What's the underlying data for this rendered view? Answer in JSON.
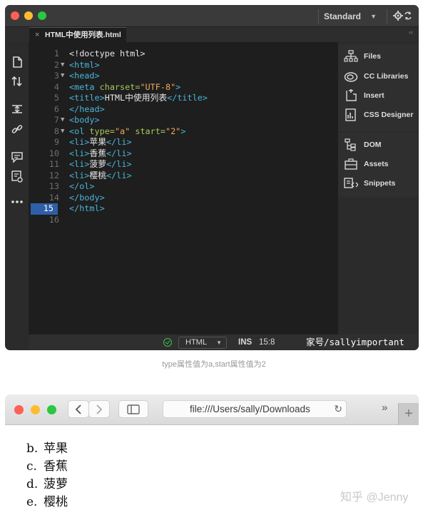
{
  "editor": {
    "workspace": "Standard",
    "tab": {
      "filename": "HTML中使用列表.html",
      "close": "×"
    },
    "collapse": "‹‹",
    "lines": [
      {
        "n": "1",
        "fold": "",
        "tokens": [
          {
            "c": "t-text",
            "t": "<!doctype html>"
          }
        ]
      },
      {
        "n": "2",
        "fold": "▼",
        "tokens": [
          {
            "c": "t-tag",
            "t": "<html>"
          }
        ]
      },
      {
        "n": "3",
        "fold": "▼",
        "tokens": [
          {
            "c": "t-tag",
            "t": "<head>"
          }
        ]
      },
      {
        "n": "4",
        "fold": "",
        "tokens": [
          {
            "c": "t-tag",
            "t": "<meta "
          },
          {
            "c": "t-attr",
            "t": "charset="
          },
          {
            "c": "t-str",
            "t": "\"UTF-8\""
          },
          {
            "c": "t-tag",
            "t": ">"
          }
        ]
      },
      {
        "n": "5",
        "fold": "",
        "tokens": [
          {
            "c": "t-tag",
            "t": "<title>"
          },
          {
            "c": "t-text",
            "t": "HTML中使用列表"
          },
          {
            "c": "t-tag",
            "t": "</title>"
          }
        ]
      },
      {
        "n": "6",
        "fold": "",
        "tokens": [
          {
            "c": "t-tag",
            "t": "</head>"
          }
        ]
      },
      {
        "n": "7",
        "fold": "▼",
        "tokens": [
          {
            "c": "t-tag",
            "t": "<body>"
          }
        ]
      },
      {
        "n": "8",
        "fold": "▼",
        "tokens": [
          {
            "c": "t-tag",
            "t": "<ol "
          },
          {
            "c": "t-attr",
            "t": "type="
          },
          {
            "c": "t-str",
            "t": "\"a\""
          },
          {
            "c": "t-attr",
            "t": " start="
          },
          {
            "c": "t-str",
            "t": "\"2\""
          },
          {
            "c": "t-tag",
            "t": ">"
          }
        ]
      },
      {
        "n": "9",
        "fold": "",
        "tokens": [
          {
            "c": "t-tag",
            "t": "<li>"
          },
          {
            "c": "t-text",
            "t": "苹果"
          },
          {
            "c": "t-tag",
            "t": "</li>"
          }
        ]
      },
      {
        "n": "10",
        "fold": "",
        "tokens": [
          {
            "c": "t-tag",
            "t": "<li>"
          },
          {
            "c": "t-text",
            "t": "香蕉"
          },
          {
            "c": "t-tag",
            "t": "</li>"
          }
        ]
      },
      {
        "n": "11",
        "fold": "",
        "tokens": [
          {
            "c": "t-tag",
            "t": "<li>"
          },
          {
            "c": "t-text",
            "t": "菠萝"
          },
          {
            "c": "t-tag",
            "t": "</li>"
          }
        ]
      },
      {
        "n": "12",
        "fold": "",
        "tokens": [
          {
            "c": "t-tag",
            "t": "<li>"
          },
          {
            "c": "t-text",
            "t": "樱桃"
          },
          {
            "c": "t-tag",
            "t": "</li>"
          }
        ]
      },
      {
        "n": "13",
        "fold": "",
        "tokens": [
          {
            "c": "t-tag",
            "t": "</ol>"
          }
        ]
      },
      {
        "n": "14",
        "fold": "",
        "tokens": [
          {
            "c": "t-tag",
            "t": "</body>"
          }
        ]
      },
      {
        "n": "15",
        "fold": "",
        "tokens": [
          {
            "c": "t-tag",
            "t": "</html>"
          }
        ]
      },
      {
        "n": "16",
        "fold": "",
        "tokens": []
      }
    ],
    "active_line": "15",
    "status": {
      "language": "HTML",
      "mode": "INS",
      "position": "15:8",
      "watermark": "家号/sallyimportant"
    }
  },
  "toolbar_icons": [
    "file-icon",
    "sort-icon",
    "expand-icon",
    "link-icon",
    "comment-icon",
    "format-icon",
    "more-icon"
  ],
  "panels": {
    "group1": [
      "Files",
      "CC Libraries",
      "Insert",
      "CSS Designer"
    ],
    "group2": [
      "DOM",
      "Assets",
      "Snippets"
    ]
  },
  "caption": "type属性值为a,start属性值为2",
  "browser": {
    "address": "file:///Users/sally/Downloads",
    "more": "»",
    "newtab": "+",
    "list": [
      {
        "marker": "b.",
        "text": "苹果"
      },
      {
        "marker": "c.",
        "text": "香蕉"
      },
      {
        "marker": "d.",
        "text": "菠萝"
      },
      {
        "marker": "e.",
        "text": "樱桃"
      }
    ],
    "watermark": "知乎 @Jenny"
  },
  "colors": {
    "accent": "#2e5fa8",
    "tag": "#49b5d9",
    "attr": "#a8c75b",
    "string": "#f0a85b",
    "ok": "#3fbf4f"
  }
}
